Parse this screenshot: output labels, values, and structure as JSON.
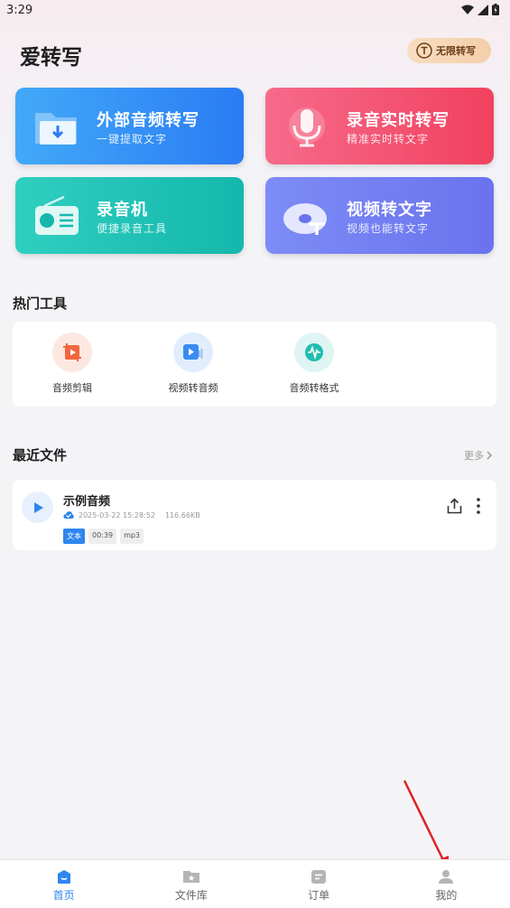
{
  "status_bar": {
    "time": "3:29"
  },
  "header": {
    "title": "爱转写",
    "vip_label": "无限转写"
  },
  "feature_cards": [
    {
      "title": "外部音频转写",
      "subtitle": "一键提取文字"
    },
    {
      "title": "录音实时转写",
      "subtitle": "精准实时转文字"
    },
    {
      "title": "录音机",
      "subtitle": "便捷录音工具"
    },
    {
      "title": "视频转文字",
      "subtitle": "视频也能转文字"
    }
  ],
  "hot_tools": {
    "title": "热门工具",
    "items": [
      {
        "label": "音频剪辑"
      },
      {
        "label": "视频转音频"
      },
      {
        "label": "音频转格式"
      }
    ]
  },
  "recent_files": {
    "title": "最近文件",
    "more_label": "更多",
    "items": [
      {
        "name": "示例音频",
        "date": "2025-03-22 15:28:52",
        "size": "116.66KB",
        "tags": [
          "文本",
          "00:39",
          "mp3"
        ]
      }
    ]
  },
  "tabbar": {
    "items": [
      {
        "label": "首页",
        "active": true
      },
      {
        "label": "文件库",
        "active": false
      },
      {
        "label": "订单",
        "active": false
      },
      {
        "label": "我的",
        "active": false
      }
    ]
  },
  "colors": {
    "accent": "#2f86ee",
    "card_external": "#2a7cf4",
    "card_record": "#f1415f",
    "card_recorder": "#15b7ac",
    "card_video": "#6a73ed",
    "vip_badge": "#f3cfa9"
  }
}
